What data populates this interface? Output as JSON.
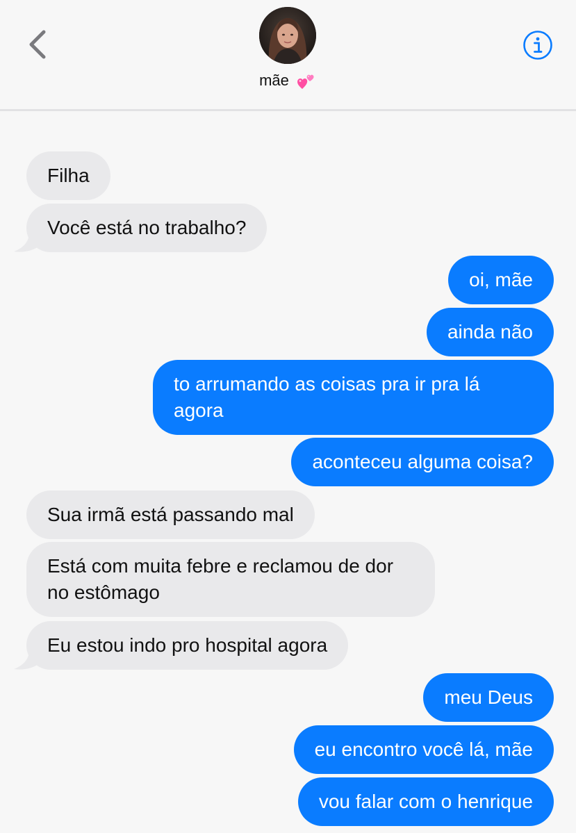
{
  "header": {
    "contact_name": "mãe",
    "back_icon": "chevron-left-icon",
    "info_icon": "info-circle-icon",
    "name_emoji": "two-hearts-icon",
    "accent_color": "#0a7cff",
    "back_color": "#7a7a7e"
  },
  "messages": [
    {
      "from": "them",
      "text": "Filha"
    },
    {
      "from": "them",
      "text": "Você está no trabalho?"
    },
    {
      "from": "me",
      "text": "oi, mãe"
    },
    {
      "from": "me",
      "text": "ainda não"
    },
    {
      "from": "me",
      "text": "to arrumando as coisas pra ir pra lá agora"
    },
    {
      "from": "me",
      "text": "aconteceu alguma coisa?"
    },
    {
      "from": "them",
      "text": "Sua irmã está passando mal"
    },
    {
      "from": "them",
      "text": "Está com muita febre e reclamou de dor no estômago"
    },
    {
      "from": "them",
      "text": "Eu estou indo pro hospital agora"
    },
    {
      "from": "me",
      "text": "meu Deus"
    },
    {
      "from": "me",
      "text": "eu encontro você lá, mãe"
    },
    {
      "from": "me",
      "text": "vou falar com o henrique"
    }
  ],
  "colors": {
    "incoming_bubble": "#e9e9eb",
    "outgoing_bubble": "#0a7cff",
    "background": "#f7f7f7"
  }
}
